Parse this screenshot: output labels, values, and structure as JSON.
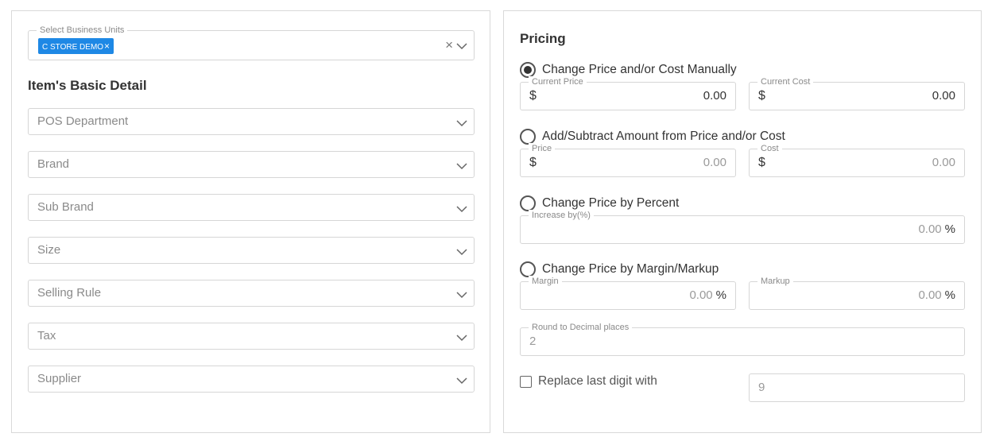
{
  "business_units": {
    "label": "Select Business Units",
    "selected": [
      "C STORE DEMO"
    ],
    "chip_remove": "×",
    "clear": "×"
  },
  "basic_detail": {
    "heading": "Item's Basic Detail",
    "selects": [
      {
        "placeholder": "POS Department"
      },
      {
        "placeholder": "Brand"
      },
      {
        "placeholder": "Sub Brand"
      },
      {
        "placeholder": "Size"
      },
      {
        "placeholder": "Selling Rule"
      },
      {
        "placeholder": "Tax"
      },
      {
        "placeholder": "Supplier"
      }
    ]
  },
  "pricing": {
    "heading": "Pricing",
    "manual": {
      "label": "Change Price and/or Cost Manually",
      "checked": true,
      "price_label": "Current Price",
      "price_prefix": "$",
      "price_value": "0.00",
      "cost_label": "Current Cost",
      "cost_prefix": "$",
      "cost_value": "0.00"
    },
    "add_subtract": {
      "label": "Add/Subtract Amount from Price and/or Cost",
      "checked": false,
      "price_label": "Price",
      "price_prefix": "$",
      "price_value": "0.00",
      "cost_label": "Cost",
      "cost_prefix": "$",
      "cost_value": "0.00"
    },
    "percent": {
      "label": "Change Price by Percent",
      "checked": false,
      "increase_label": "Increase by(%)",
      "increase_value": "0.00",
      "unit": "%"
    },
    "margin": {
      "label": "Change Price by Margin/Markup",
      "checked": false,
      "margin_label": "Margin",
      "margin_value": "0.00",
      "markup_label": "Markup",
      "markup_value": "0.00",
      "unit": "%"
    },
    "round": {
      "label": "Round to Decimal places",
      "value": "2"
    },
    "replace_digit": {
      "label": "Replace last digit with",
      "checked": false,
      "value": "9"
    }
  }
}
